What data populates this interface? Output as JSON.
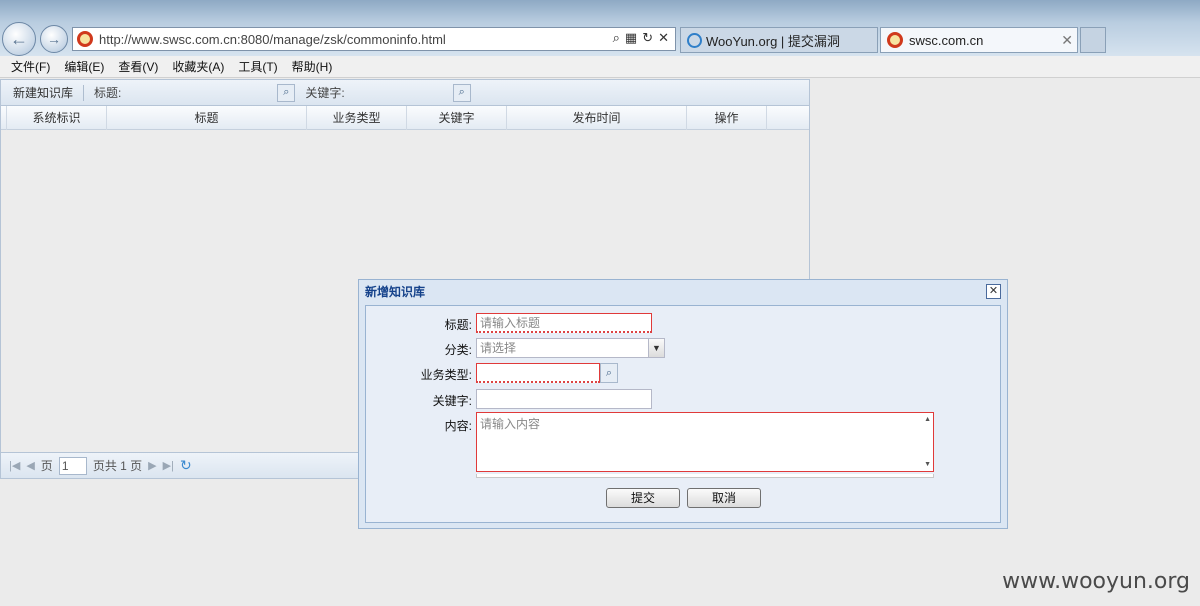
{
  "browser": {
    "url": "http://www.swsc.com.cn:8080/manage/zsk/commoninfo.html",
    "tabs": [
      {
        "label": "WooYun.org | 提交漏洞"
      },
      {
        "label": "swsc.com.cn"
      }
    ]
  },
  "menu": [
    "文件(F)",
    "编辑(E)",
    "查看(V)",
    "收藏夹(A)",
    "工具(T)",
    "帮助(H)"
  ],
  "toolbar": {
    "new_label": "新建知识库",
    "title_label": "标题:",
    "keyword_label": "关键字:"
  },
  "grid": {
    "columns": [
      "系统标识",
      "标题",
      "业务类型",
      "关键字",
      "发布时间",
      "操作"
    ]
  },
  "pager": {
    "page_prefix": "页",
    "page_value": "1",
    "page_suffix": "页共 1 页"
  },
  "dialog": {
    "title": "新增知识库",
    "fields": {
      "title_label": "标题:",
      "title_placeholder": "请输入标题",
      "category_label": "分类:",
      "category_value": "请选择",
      "biztype_label": "业务类型:",
      "keyword_label": "关键字:",
      "content_label": "内容:",
      "content_placeholder": "请输入内容"
    },
    "submit_label": "提交",
    "cancel_label": "取消"
  },
  "watermark": "www.wooyun.org",
  "colors": {
    "dialog_title": "#15428b",
    "invalid_border": "#e03a3a",
    "panel_border": "#b5c4d6"
  }
}
